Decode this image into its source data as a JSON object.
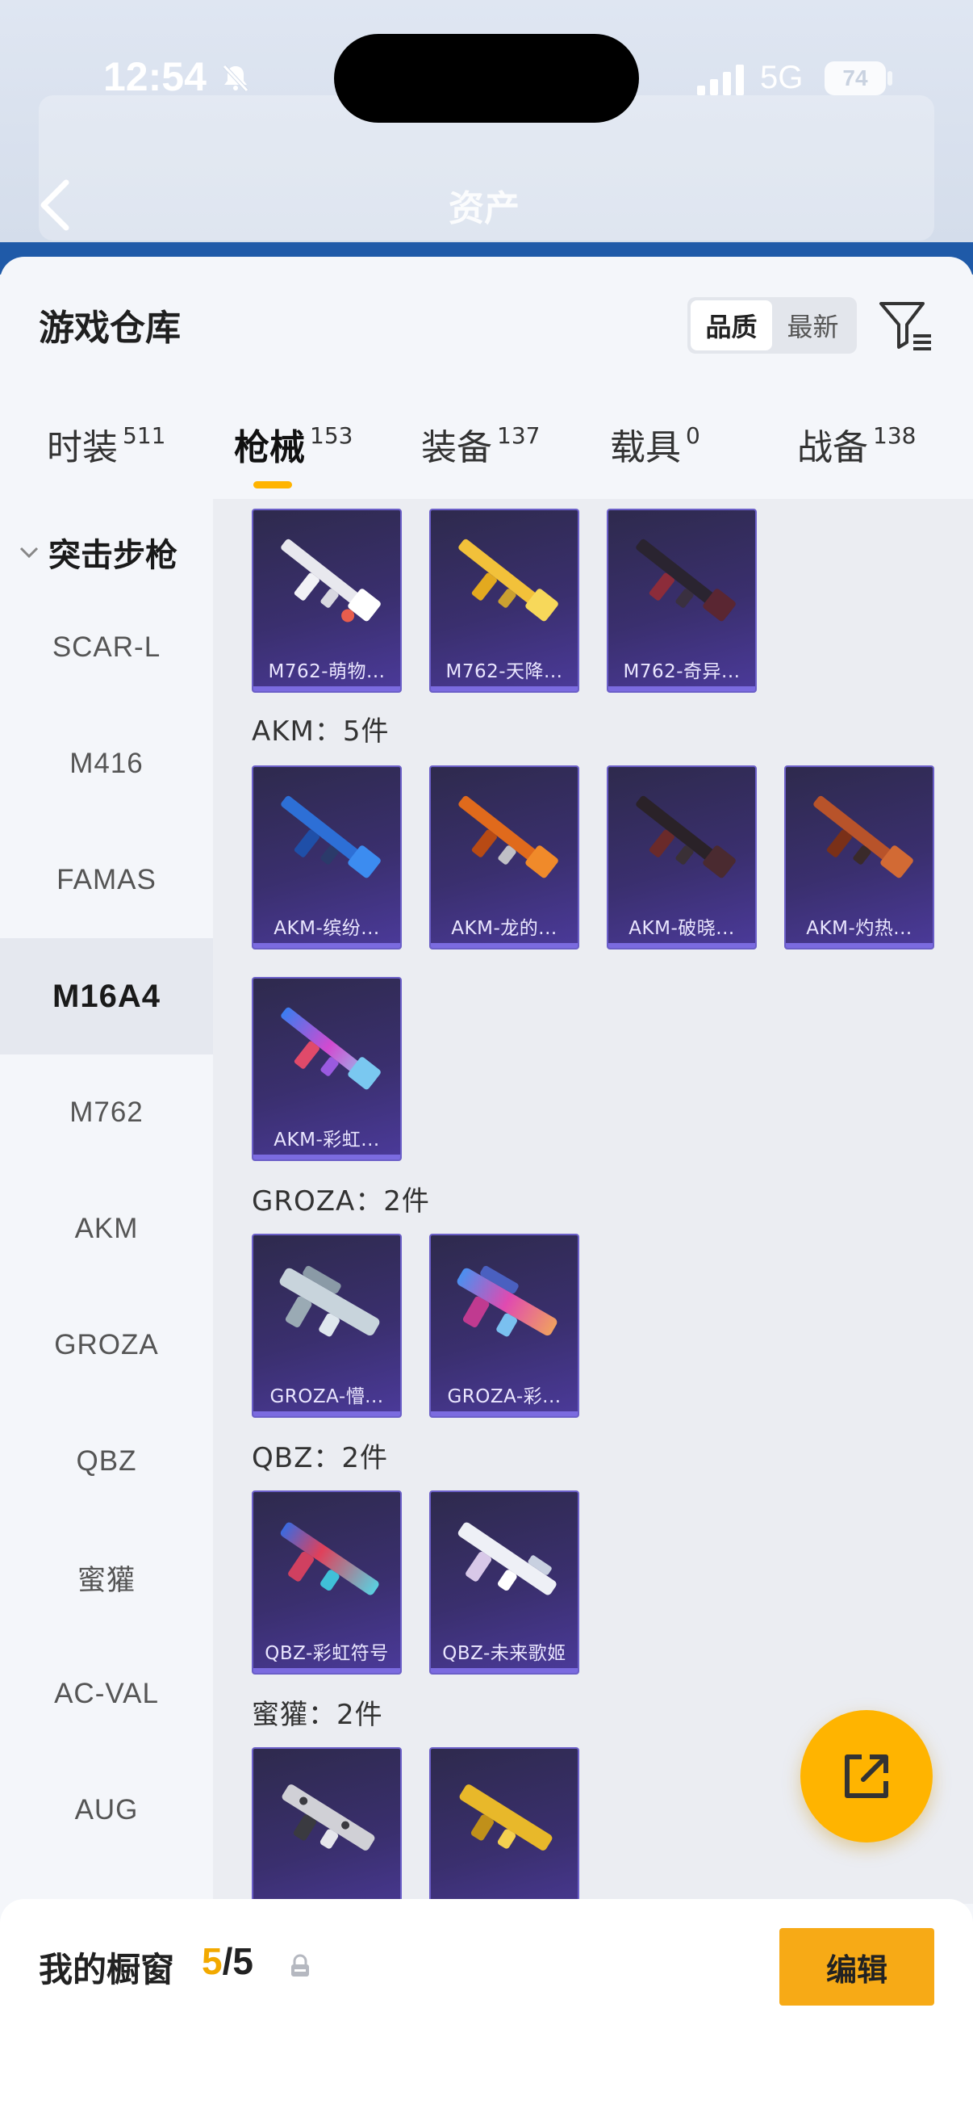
{
  "status_bar": {
    "time": "12:54",
    "network": "5G",
    "battery": "74"
  },
  "header": {
    "title": "资产"
  },
  "sheet": {
    "title": "游戏仓库",
    "sort_options": [
      "品质",
      "最新"
    ],
    "sort_selected": "品质"
  },
  "tabs": [
    {
      "label": "时装",
      "count": "511"
    },
    {
      "label": "枪械",
      "count": "153",
      "active": true
    },
    {
      "label": "装备",
      "count": "137"
    },
    {
      "label": "载具",
      "count": "0"
    },
    {
      "label": "战备",
      "count": "138"
    }
  ],
  "sidebar": {
    "group": "突击步枪",
    "items": [
      "SCAR-L",
      "M416",
      "FAMAS",
      "M16A4",
      "M762",
      "AKM",
      "GROZA",
      "QBZ",
      "蜜獾",
      "AC-VAL",
      "AUG"
    ],
    "selected": "M16A4"
  },
  "groups": {
    "m762": {
      "items": [
        "M762-萌物...",
        "M762-天降...",
        "M762-奇异..."
      ]
    },
    "akm": {
      "label": "AKM：5件",
      "items": [
        "AKM-缤纷...",
        "AKM-龙的...",
        "AKM-破晓...",
        "AKM-灼热...",
        "AKM-彩虹..."
      ]
    },
    "groza": {
      "label": "GROZA：2件",
      "items": [
        "GROZA-懵...",
        "GROZA-彩..."
      ]
    },
    "qbz": {
      "label": "QBZ：2件",
      "items": [
        "QBZ-彩虹符号",
        "QBZ-未来歌姬"
      ]
    },
    "honeybadger": {
      "label": "蜜獾：2件",
      "items": [
        "",
        ""
      ]
    }
  },
  "bottom": {
    "title": "我的橱窗",
    "count_current": "5",
    "count_sep": "/5",
    "edit_label": "编辑"
  },
  "colors": {
    "accent": "#ffb400",
    "card_bg": "#3a2f6e",
    "edit_button": "#f7aa16"
  }
}
